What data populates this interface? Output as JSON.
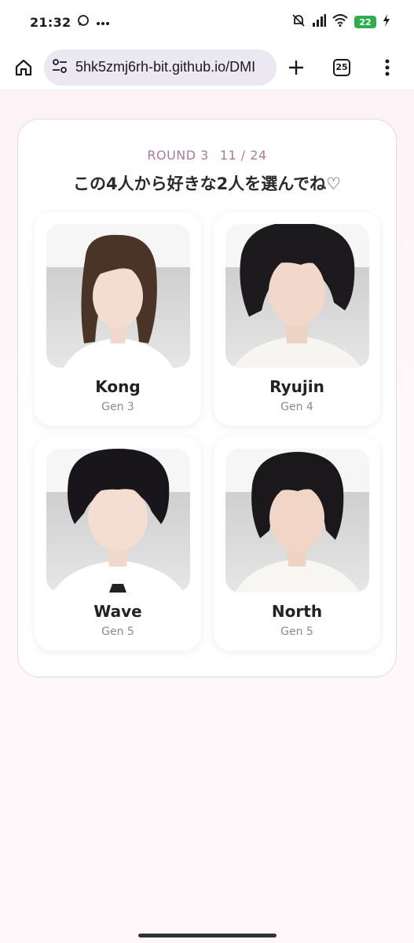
{
  "status_bar": {
    "time": "21:32",
    "battery": "22",
    "icons": [
      "chat-bubble-icon",
      "more-dots-icon",
      "mute-bell-icon",
      "signal-icon",
      "wifi-icon",
      "battery-icon",
      "charging-bolt-icon"
    ]
  },
  "browser": {
    "url": "5hk5zmj6rh-bit.github.io/DMI",
    "tab_count": "25",
    "icons": [
      "home-icon",
      "site-settings-icon",
      "plus-icon",
      "tabs-icon",
      "menu-dots-icon"
    ]
  },
  "game": {
    "round_label": "ROUND 3",
    "progress": "11 / 24",
    "prompt": "この4人から好きな2人を選んでね♡",
    "members": [
      {
        "name": "Kong",
        "gen": "Gen 3"
      },
      {
        "name": "Ryujin",
        "gen": "Gen 4"
      },
      {
        "name": "Wave",
        "gen": "Gen 5"
      },
      {
        "name": "North",
        "gen": "Gen 5"
      }
    ]
  },
  "colors": {
    "accent": "#b07a96",
    "page_bg": "#fdf2f6",
    "card_border": "#ead6e0"
  }
}
